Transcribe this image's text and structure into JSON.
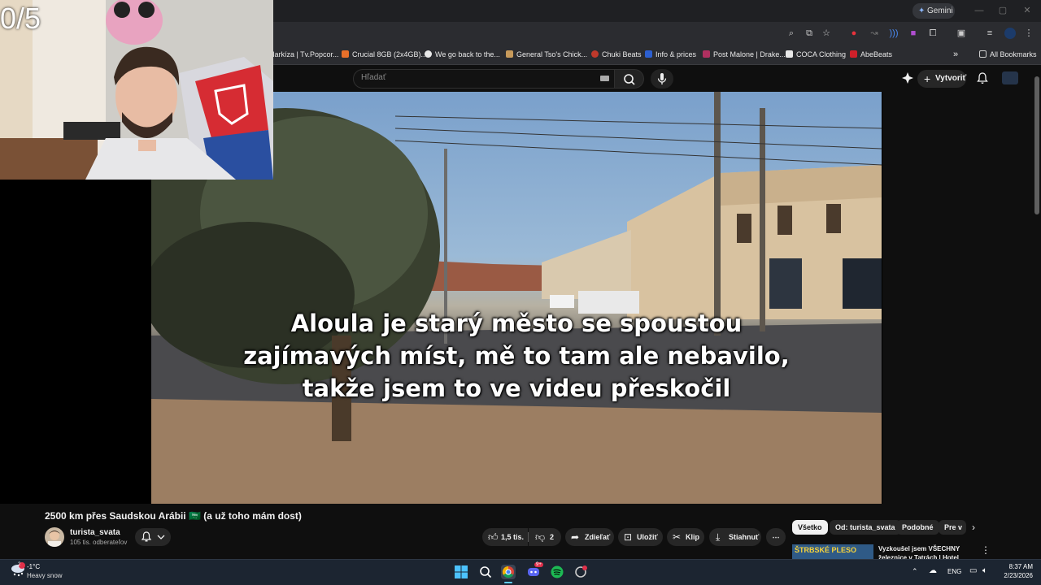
{
  "overlay": {
    "counter": "0/5"
  },
  "browser": {
    "gemini_label": "Gemini",
    "bookmarks": [
      {
        "label": "Markíza | Tv.Popcor...",
        "color": "#3a3b3f"
      },
      {
        "label": "Crucial 8GB (2x4GB)...",
        "color": "#e8702a"
      },
      {
        "label": "We go back to the...",
        "color": "#e8e8e8"
      },
      {
        "label": "General Tso's Chick...",
        "color": "#c79a5b"
      },
      {
        "label": "Chuki Beats",
        "color": "#c0392b"
      },
      {
        "label": "Info & prices",
        "color": "#2c5fd0"
      },
      {
        "label": "Post Malone | Drake...",
        "color": "#b03060"
      },
      {
        "label": "COCA Clothing",
        "color": "#e8e8e8"
      },
      {
        "label": "AbeBeats",
        "color": "#d0202a"
      }
    ],
    "all_bookmarks": "All Bookmarks"
  },
  "youtube": {
    "search_placeholder": "Hľadať",
    "create_label": "Vytvoriť"
  },
  "video": {
    "subtitles": [
      "Aloula je starý město se spoustou",
      "zajímavých míst, mě to tam ale nebavilo,",
      "takže jsem to ve videu přeskočil"
    ],
    "title": "2500 km přes Saudskou Arábii 🇸🇦 (a už toho mám dost)",
    "channel_name": "turista_svata",
    "channel_subs": "105 tis. odberateľov",
    "likes": "1,5 tis.",
    "dislikes": "2",
    "share_label": "Zdieľať",
    "save_label": "Uložiť",
    "clip_label": "Klip",
    "download_label": "Stiahnuť"
  },
  "recommendations": {
    "chips": [
      "Všetko",
      "Od: turista_svata",
      "Podobné",
      "Pre v"
    ],
    "first_title": "Vyzkoušel jsem VŠECHNY železnice v Tatrách | Hotel",
    "first_thumb_text": "ŠTRBSKÉ PLESO"
  },
  "taskbar": {
    "weather_temp": "-1°C",
    "weather_desc": "Heavy snow",
    "lang": "ENG",
    "time": "8:37 AM",
    "date": "2/23/2026",
    "discord_badge": "9+",
    "weather_badge": "2"
  },
  "colors": {
    "accent_red": "#ff0033",
    "chip_active_bg": "#f1f1f1",
    "chip_bg": "#272727"
  }
}
